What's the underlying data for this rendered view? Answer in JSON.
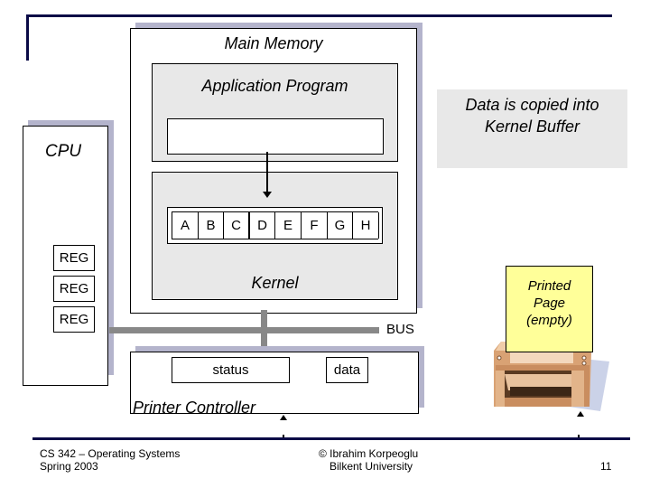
{
  "main_memory": {
    "title": "Main Memory",
    "application_program": "Application Program",
    "kernel": "Kernel",
    "kernel_buffer_cells": [
      "A",
      "B",
      "C",
      "D",
      "E",
      "F",
      "G",
      "H"
    ]
  },
  "cpu": {
    "title": "CPU",
    "registers": [
      "REG",
      "REG",
      "REG"
    ]
  },
  "bus": {
    "label": "BUS"
  },
  "printer_controller": {
    "title": "Printer Controller",
    "status": "status",
    "data": "data"
  },
  "callout": {
    "line1": "Data is copied into",
    "line2": "Kernel Buffer"
  },
  "printed_page": {
    "line1": "Printed",
    "line2": "Page",
    "line3": "(empty)"
  },
  "footer": {
    "course": "CS 342 – Operating Systems",
    "term": "Spring 2003",
    "author": "© Ibrahim Korpeoglu",
    "institution": "Bilkent University",
    "page_number": "11"
  },
  "colors": {
    "rule": "#0a0a46",
    "shadow": "#b4b4cc",
    "panel": "#e8e8e8",
    "bus": "#888888",
    "note": "#ffff99"
  }
}
